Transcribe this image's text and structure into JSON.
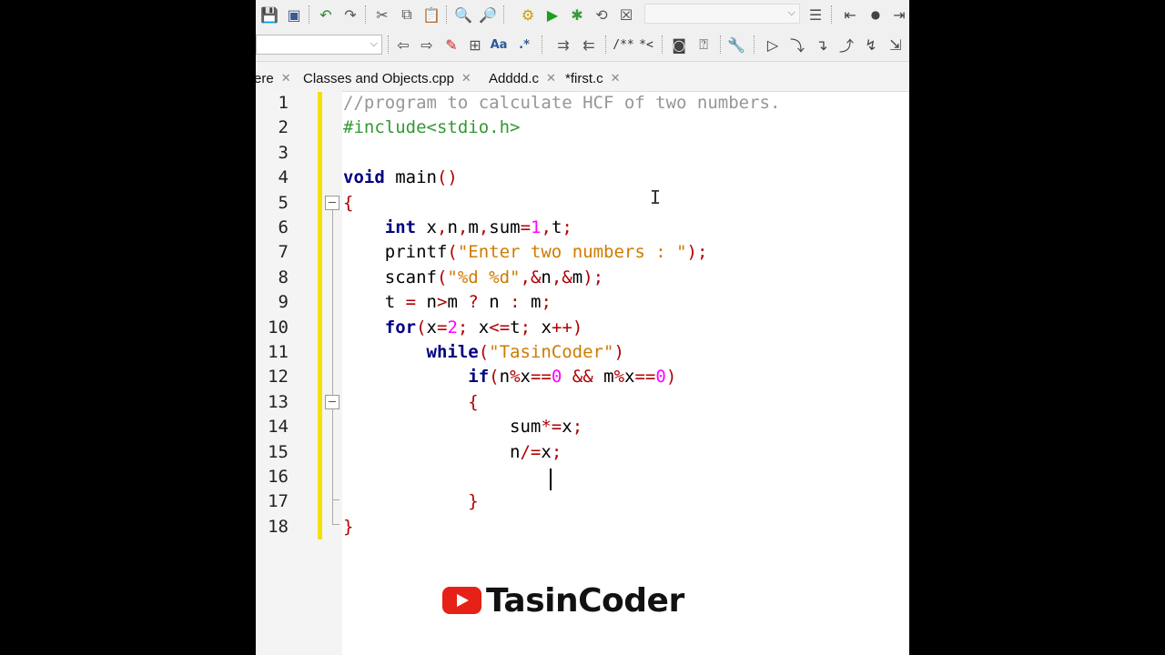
{
  "toolbar1": {
    "icons": [
      "save-icon",
      "save-all-icon",
      "undo-icon",
      "redo-icon",
      "cut-icon",
      "copy-icon",
      "paste-icon",
      "find-icon",
      "find-next-icon",
      "compile-icon",
      "run-icon",
      "compile-run-icon",
      "rebuild-icon",
      "stop-icon",
      "file-list-icon",
      "goto-prev-icon",
      "bookmark-icon",
      "goto-next-icon"
    ],
    "combo_value": ""
  },
  "toolbar2": {
    "combo_value": "",
    "comment_label": "/**",
    "uncomment_label": "*<"
  },
  "tabs": [
    {
      "label": "ere"
    },
    {
      "label": "Classes and Objects.cpp"
    },
    {
      "label": "Adddd.c"
    },
    {
      "label": "*first.c"
    }
  ],
  "editor": {
    "line_numbers": [
      "1",
      "2",
      "3",
      "4",
      "5",
      "6",
      "7",
      "8",
      "9",
      "10",
      "11",
      "12",
      "13",
      "14",
      "15",
      "16",
      "17",
      "18"
    ],
    "lines": [
      {
        "indent": "",
        "parts": [
          {
            "t": "cm",
            "v": "//program to calculate HCF of two numbers."
          }
        ]
      },
      {
        "indent": "",
        "parts": [
          {
            "t": "pp",
            "v": "#include<stdio.h>"
          }
        ]
      },
      {
        "indent": "",
        "parts": []
      },
      {
        "indent": "",
        "parts": [
          {
            "t": "kw",
            "v": "void"
          },
          {
            "t": "tx",
            "v": " main"
          },
          {
            "t": "op",
            "v": "()"
          }
        ]
      },
      {
        "indent": "",
        "parts": [
          {
            "t": "op",
            "v": "{"
          }
        ]
      },
      {
        "indent": "    ",
        "parts": [
          {
            "t": "kw",
            "v": "int"
          },
          {
            "t": "tx",
            "v": " x"
          },
          {
            "t": "op",
            "v": ","
          },
          {
            "t": "tx",
            "v": "n"
          },
          {
            "t": "op",
            "v": ","
          },
          {
            "t": "tx",
            "v": "m"
          },
          {
            "t": "op",
            "v": ","
          },
          {
            "t": "tx",
            "v": "sum"
          },
          {
            "t": "op",
            "v": "="
          },
          {
            "t": "nm",
            "v": "1"
          },
          {
            "t": "op",
            "v": ","
          },
          {
            "t": "tx",
            "v": "t"
          },
          {
            "t": "op",
            "v": ";"
          }
        ]
      },
      {
        "indent": "    ",
        "parts": [
          {
            "t": "tx",
            "v": "printf"
          },
          {
            "t": "op",
            "v": "("
          },
          {
            "t": "st",
            "v": "\"Enter two numbers : \""
          },
          {
            "t": "op",
            "v": ");"
          }
        ]
      },
      {
        "indent": "    ",
        "parts": [
          {
            "t": "tx",
            "v": "scanf"
          },
          {
            "t": "op",
            "v": "("
          },
          {
            "t": "st",
            "v": "\"%d %d\""
          },
          {
            "t": "op",
            "v": ",&"
          },
          {
            "t": "tx",
            "v": "n"
          },
          {
            "t": "op",
            "v": ",&"
          },
          {
            "t": "tx",
            "v": "m"
          },
          {
            "t": "op",
            "v": ");"
          }
        ]
      },
      {
        "indent": "    ",
        "parts": [
          {
            "t": "tx",
            "v": "t "
          },
          {
            "t": "op",
            "v": "="
          },
          {
            "t": "tx",
            "v": " n"
          },
          {
            "t": "op",
            "v": ">"
          },
          {
            "t": "tx",
            "v": "m "
          },
          {
            "t": "op",
            "v": "?"
          },
          {
            "t": "tx",
            "v": " n "
          },
          {
            "t": "op",
            "v": ":"
          },
          {
            "t": "tx",
            "v": " m"
          },
          {
            "t": "op",
            "v": ";"
          }
        ]
      },
      {
        "indent": "    ",
        "parts": [
          {
            "t": "kw",
            "v": "for"
          },
          {
            "t": "op",
            "v": "("
          },
          {
            "t": "tx",
            "v": "x"
          },
          {
            "t": "op",
            "v": "="
          },
          {
            "t": "nm",
            "v": "2"
          },
          {
            "t": "op",
            "v": ";"
          },
          {
            "t": "tx",
            "v": " x"
          },
          {
            "t": "op",
            "v": "<="
          },
          {
            "t": "tx",
            "v": "t"
          },
          {
            "t": "op",
            "v": ";"
          },
          {
            "t": "tx",
            "v": " x"
          },
          {
            "t": "op",
            "v": "++)"
          }
        ]
      },
      {
        "indent": "        ",
        "parts": [
          {
            "t": "kw",
            "v": "while"
          },
          {
            "t": "op",
            "v": "("
          },
          {
            "t": "st",
            "v": "\"TasinCoder\""
          },
          {
            "t": "op",
            "v": ")"
          }
        ]
      },
      {
        "indent": "            ",
        "parts": [
          {
            "t": "kw",
            "v": "if"
          },
          {
            "t": "op",
            "v": "("
          },
          {
            "t": "tx",
            "v": "n"
          },
          {
            "t": "op",
            "v": "%"
          },
          {
            "t": "tx",
            "v": "x"
          },
          {
            "t": "op",
            "v": "=="
          },
          {
            "t": "nm",
            "v": "0"
          },
          {
            "t": "tx",
            "v": " "
          },
          {
            "t": "op",
            "v": "&&"
          },
          {
            "t": "tx",
            "v": " m"
          },
          {
            "t": "op",
            "v": "%"
          },
          {
            "t": "tx",
            "v": "x"
          },
          {
            "t": "op",
            "v": "=="
          },
          {
            "t": "nm",
            "v": "0"
          },
          {
            "t": "op",
            "v": ")"
          }
        ]
      },
      {
        "indent": "            ",
        "parts": [
          {
            "t": "op",
            "v": "{"
          }
        ]
      },
      {
        "indent": "                ",
        "parts": [
          {
            "t": "tx",
            "v": "sum"
          },
          {
            "t": "op",
            "v": "*="
          },
          {
            "t": "tx",
            "v": "x"
          },
          {
            "t": "op",
            "v": ";"
          }
        ]
      },
      {
        "indent": "                ",
        "parts": [
          {
            "t": "tx",
            "v": "n"
          },
          {
            "t": "op",
            "v": "/="
          },
          {
            "t": "tx",
            "v": "x"
          },
          {
            "t": "op",
            "v": ";"
          }
        ]
      },
      {
        "indent": "",
        "parts": []
      },
      {
        "indent": "            ",
        "parts": [
          {
            "t": "op",
            "v": "}"
          }
        ]
      },
      {
        "indent": "",
        "parts": [
          {
            "t": "op",
            "v": "}"
          }
        ]
      }
    ]
  },
  "watermark": {
    "icon": "youtube-icon",
    "text": "TasinCoder",
    "icon_color": "#e62117"
  }
}
